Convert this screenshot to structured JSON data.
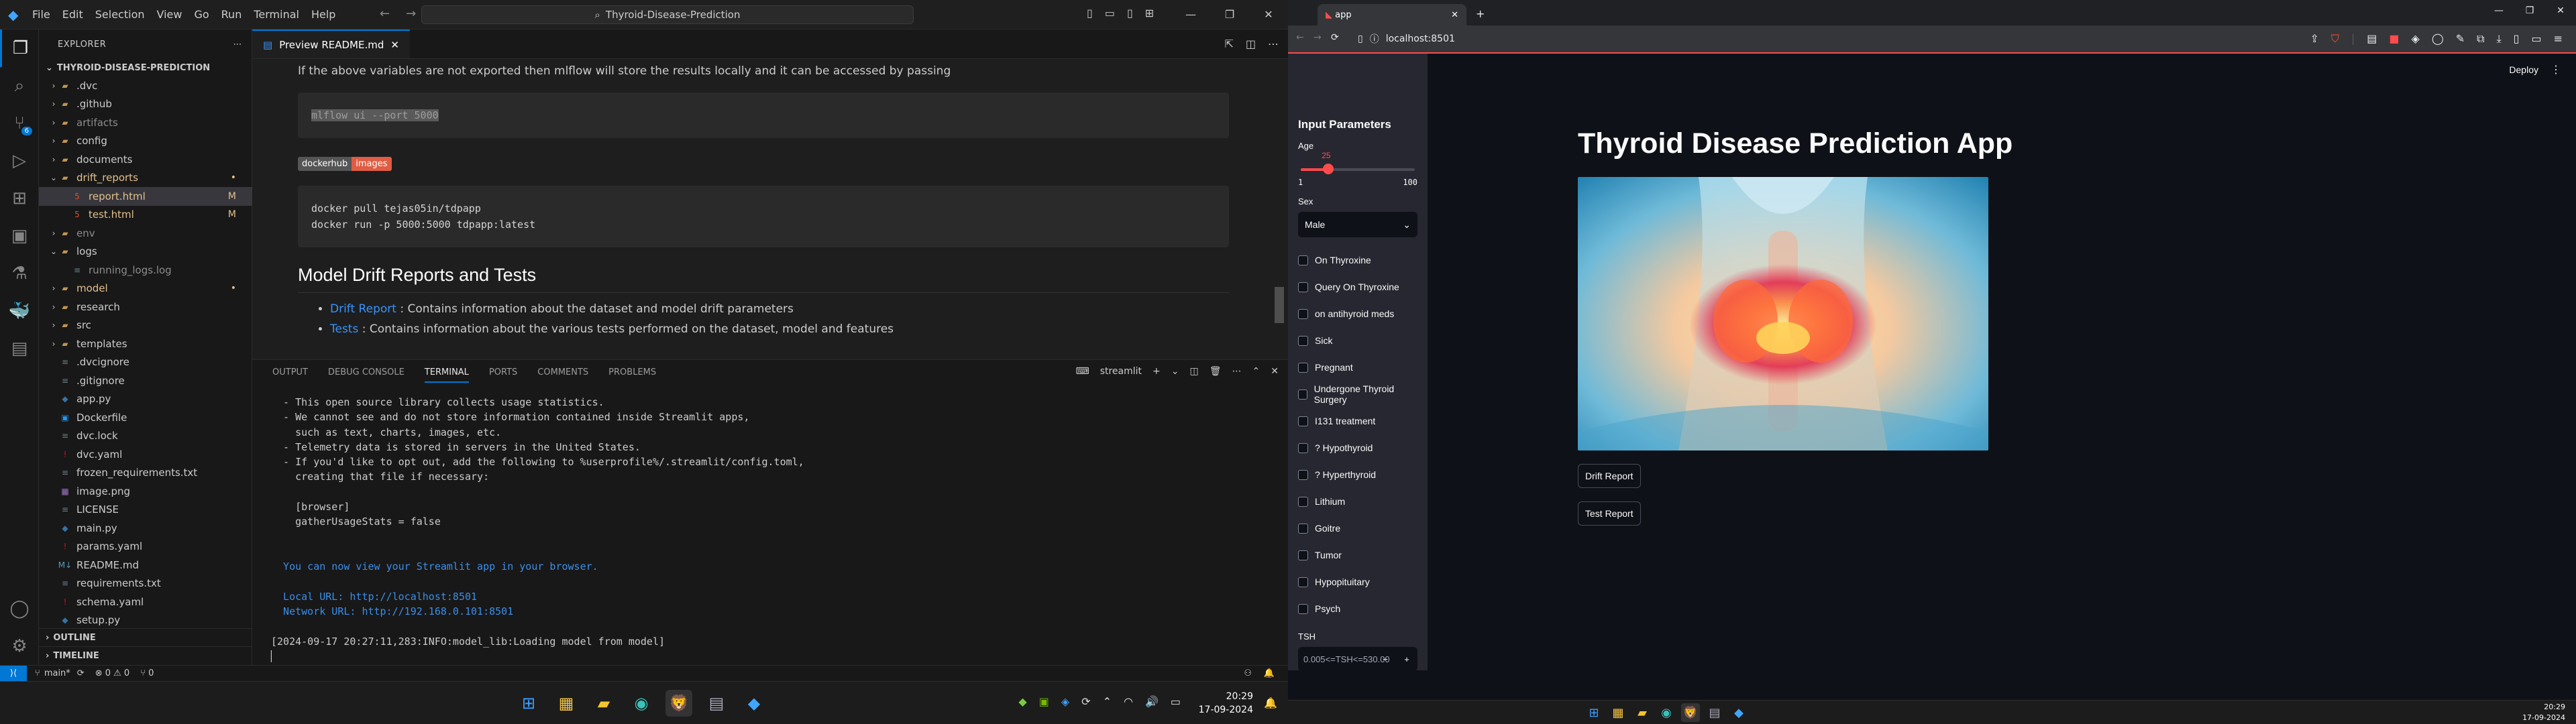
{
  "vscode": {
    "menu": [
      "File",
      "Edit",
      "Selection",
      "View",
      "Go",
      "Run",
      "Terminal",
      "Help"
    ],
    "command_center": "Thyroid-Disease-Prediction",
    "explorer": {
      "title": "EXPLORER",
      "root": "THYROID-DISEASE-PREDICTION",
      "items": [
        {
          "name": ".dvc",
          "kind": "folder",
          "depth": 0,
          "status": ""
        },
        {
          "name": ".github",
          "kind": "folder",
          "depth": 0,
          "status": ""
        },
        {
          "name": "artifacts",
          "kind": "folder",
          "depth": 0,
          "status": "",
          "dim": true
        },
        {
          "name": "config",
          "kind": "folder",
          "depth": 0,
          "status": ""
        },
        {
          "name": "documents",
          "kind": "folder",
          "depth": 0,
          "status": ""
        },
        {
          "name": "drift_reports",
          "kind": "folder-open",
          "depth": 0,
          "status": "•",
          "git": true
        },
        {
          "name": "report.html",
          "kind": "html",
          "depth": 1,
          "status": "M",
          "git": true,
          "selected": true
        },
        {
          "name": "test.html",
          "kind": "html",
          "depth": 1,
          "status": "M",
          "git": true
        },
        {
          "name": "env",
          "kind": "folder",
          "depth": 0,
          "status": "",
          "dim": true
        },
        {
          "name": "logs",
          "kind": "folder-open",
          "depth": 0,
          "status": ""
        },
        {
          "name": "running_logs.log",
          "kind": "log",
          "depth": 1,
          "status": "",
          "dim": true
        },
        {
          "name": "model",
          "kind": "folder",
          "depth": 0,
          "status": "•",
          "git": true
        },
        {
          "name": "research",
          "kind": "folder",
          "depth": 0,
          "status": ""
        },
        {
          "name": "src",
          "kind": "folder",
          "depth": 0,
          "status": ""
        },
        {
          "name": "templates",
          "kind": "folder",
          "depth": 0,
          "status": ""
        },
        {
          "name": ".dvcignore",
          "kind": "file",
          "depth": 0,
          "status": ""
        },
        {
          "name": ".gitignore",
          "kind": "file",
          "depth": 0,
          "status": ""
        },
        {
          "name": "app.py",
          "kind": "py",
          "depth": 0,
          "status": ""
        },
        {
          "name": "Dockerfile",
          "kind": "docker",
          "depth": 0,
          "status": ""
        },
        {
          "name": "dvc.lock",
          "kind": "file",
          "depth": 0,
          "status": ""
        },
        {
          "name": "dvc.yaml",
          "kind": "yaml",
          "depth": 0,
          "status": ""
        },
        {
          "name": "frozen_requirements.txt",
          "kind": "txt",
          "depth": 0,
          "status": ""
        },
        {
          "name": "image.png",
          "kind": "img",
          "depth": 0,
          "status": ""
        },
        {
          "name": "LICENSE",
          "kind": "file",
          "depth": 0,
          "status": ""
        },
        {
          "name": "main.py",
          "kind": "py",
          "depth": 0,
          "status": ""
        },
        {
          "name": "params.yaml",
          "kind": "yaml",
          "depth": 0,
          "status": ""
        },
        {
          "name": "README.md",
          "kind": "md",
          "depth": 0,
          "status": ""
        },
        {
          "name": "requirements.txt",
          "kind": "txt",
          "depth": 0,
          "status": ""
        },
        {
          "name": "schema.yaml",
          "kind": "yaml",
          "depth": 0,
          "status": ""
        },
        {
          "name": "setup.py",
          "kind": "py",
          "depth": 0,
          "status": ""
        }
      ],
      "outline": "OUTLINE",
      "timeline": "TIMELINE"
    },
    "tab": "Preview README.md",
    "preview": {
      "intro": "If the above variables are not exported then mlflow will store the results locally and it can be accessed by passing",
      "code1": "mlflow ui --port 5000",
      "badge_left": "dockerhub",
      "badge_right": "images",
      "code2_line1": "docker pull tejas05in/tdpapp",
      "code2_line2": "docker run -p 5000:5000 tdpapp:latest",
      "heading": "Model Drift Reports and Tests",
      "li1_link": "Drift Report",
      "li1_text": " : Contains information about the dataset and model drift parameters",
      "li2_link": "Tests",
      "li2_text": " : Contains information about the various tests performed on the dataset, model and features"
    },
    "panel": {
      "tabs": [
        "OUTPUT",
        "DEBUG CONSOLE",
        "TERMINAL",
        "PORTS",
        "COMMENTS",
        "PROBLEMS"
      ],
      "active": "TERMINAL",
      "shell": "streamlit",
      "lines": [
        "  - This open source library collects usage statistics.",
        "  - We cannot see and do not store information contained inside Streamlit apps,",
        "    such as text, charts, images, etc.",
        "  - Telemetry data is stored in servers in the United States.",
        "  - If you'd like to opt out, add the following to %userprofile%/.streamlit/config.toml,",
        "    creating that file if necessary:",
        "",
        "    [browser]",
        "    gatherUsageStats = false",
        "",
        "",
        "  You can now view your Streamlit app in your browser.",
        "",
        "  Local URL: http://localhost:8501",
        "  Network URL: http://192.168.0.101:8501",
        "",
        "[2024-09-17 20:27:11,283:INFO:model_lib:Loading model from model]",
        "▏"
      ]
    },
    "status": {
      "branch": "main*",
      "problems": "⊗ 0 ⚠ 0",
      "ports": "⑂ 0"
    },
    "clock": {
      "time": "20:29",
      "date": "17-09-2024"
    }
  },
  "browser": {
    "tab_title": "app",
    "url": "localhost:8501",
    "deploy": "Deploy",
    "sidebar": {
      "title": "Input Parameters",
      "age_label": "Age",
      "age_value": 25,
      "age_min": 1,
      "age_max": 100,
      "sex_label": "Sex",
      "sex_value": "Male",
      "checkboxes": [
        "On Thyroxine",
        "Query On Thyroxine",
        "on antihyroid meds",
        "Sick",
        "Pregnant",
        "Undergone Thyroid Surgery",
        "I131 treatment",
        "? Hypothyroid",
        "? Hyperthyroid",
        "Lithium",
        "Goitre",
        "Tumor",
        "Hypopituitary",
        "Psych"
      ],
      "tsh_label": "TSH",
      "tsh_placeholder": "0.005<=TSH<=530.00"
    },
    "main": {
      "title": "Thyroid Disease Prediction App",
      "drift_button": "Drift Report",
      "test_button": "Test Report"
    },
    "clock": {
      "time": "20:29",
      "date": "17-09-2024"
    }
  }
}
